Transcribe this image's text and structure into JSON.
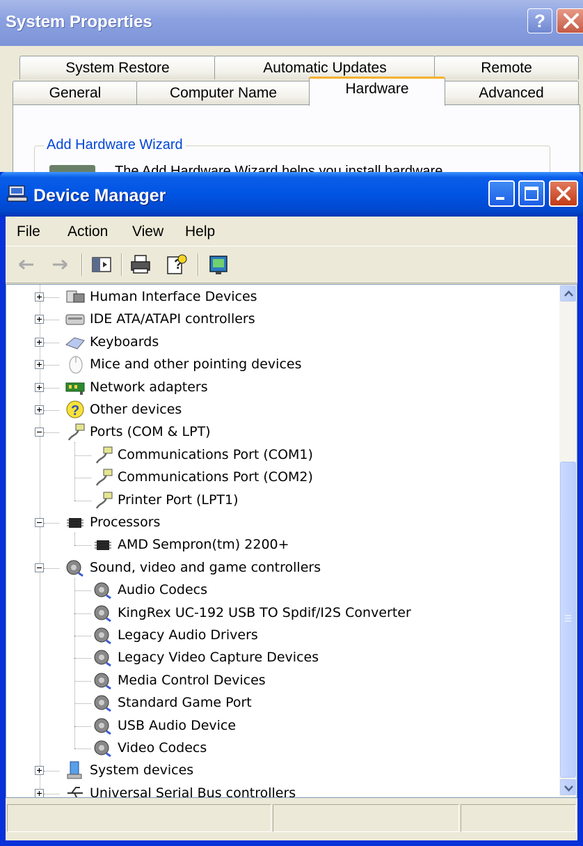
{
  "system_properties": {
    "title": "System Properties",
    "help_button": "?",
    "tabs_row1": [
      "System Restore",
      "Automatic Updates",
      "Remote"
    ],
    "tabs_row2": [
      "General",
      "Computer Name",
      "Hardware",
      "Advanced"
    ],
    "active_tab": "Hardware",
    "group_title": "Add Hardware Wizard",
    "group_text": "The Add Hardware Wizard helps you install hardware."
  },
  "device_manager": {
    "title": "Device Manager",
    "menu": [
      "File",
      "Action",
      "View",
      "Help"
    ],
    "toolbar_icons": [
      "back-arrow-icon",
      "forward-arrow-icon",
      "show-hide-console-tree-icon",
      "print-icon",
      "help-icon",
      "scan-hardware-icon"
    ],
    "tree": [
      {
        "label": "Human Interface Devices",
        "icon": "hid-icon",
        "expanded": false
      },
      {
        "label": "IDE ATA/ATAPI controllers",
        "icon": "ide-controller-icon",
        "expanded": false
      },
      {
        "label": "Keyboards",
        "icon": "keyboard-icon",
        "expanded": false
      },
      {
        "label": "Mice and other pointing devices",
        "icon": "mouse-icon",
        "expanded": false
      },
      {
        "label": "Network adapters",
        "icon": "network-adapter-icon",
        "expanded": false
      },
      {
        "label": "Other devices",
        "icon": "unknown-device-icon",
        "expanded": false
      },
      {
        "label": "Ports (COM & LPT)",
        "icon": "port-icon",
        "expanded": true,
        "children": [
          "Communications Port (COM1)",
          "Communications Port (COM2)",
          "Printer Port (LPT1)"
        ]
      },
      {
        "label": "Processors",
        "icon": "processor-icon",
        "expanded": true,
        "children": [
          "AMD Sempron(tm)  2200+"
        ]
      },
      {
        "label": "Sound, video and game controllers",
        "icon": "sound-icon",
        "expanded": true,
        "children": [
          "Audio Codecs",
          "KingRex UC-192 USB TO Spdif/I2S Converter",
          "Legacy Audio Drivers",
          "Legacy Video Capture Devices",
          "Media Control Devices",
          "Standard Game Port",
          "USB Audio Device",
          "Video Codecs"
        ]
      },
      {
        "label": "System devices",
        "icon": "system-devices-icon",
        "expanded": false
      },
      {
        "label": "Universal Serial Bus controllers",
        "icon": "usb-icon",
        "expanded": false
      }
    ]
  },
  "colors": {
    "xp_blue_title": "#0054e3",
    "window_face": "#ece9d8",
    "link_blue": "#0046d5",
    "tab_highlight": "#f7b02c"
  }
}
